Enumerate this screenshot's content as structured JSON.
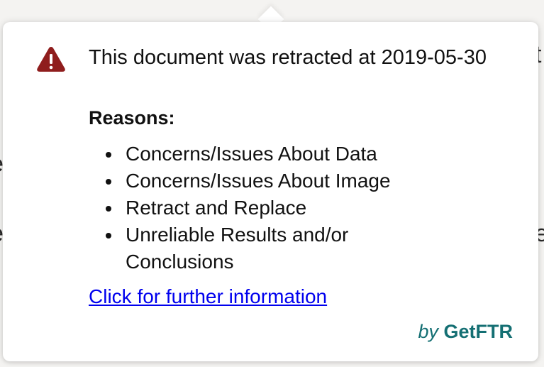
{
  "popover": {
    "title": "This document was retracted at 2019-05-30",
    "reasons_heading": "Reasons:",
    "reasons": [
      "Concerns/Issues About Data",
      "Concerns/Issues About Image",
      "Retract and Replace",
      "Unreliable Results and/or Conclusions"
    ],
    "link_text": "Click for further information",
    "brand_by": "by",
    "brand_name": "GetFTR",
    "icon": "warning-triangle-icon"
  },
  "colors": {
    "warning": "#8f1d1d",
    "link": "#0000ee",
    "brand": "#146f73"
  }
}
